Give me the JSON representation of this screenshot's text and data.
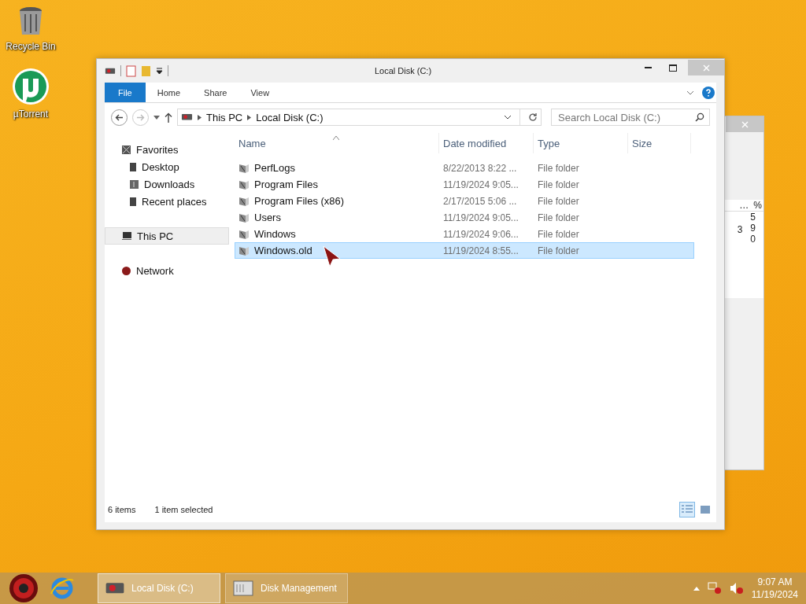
{
  "desktop_icons": [
    {
      "label": "Recycle Bin",
      "kind": "recycle"
    },
    {
      "label": "µTorrent",
      "kind": "torrent"
    }
  ],
  "back_window": {
    "header_cells": [
      "…",
      "%"
    ],
    "clipped_values": [
      "3"
    ],
    "percent_values": [
      "5",
      "9",
      "0"
    ]
  },
  "explorer": {
    "title": "Local Disk (C:)",
    "ribbon_tabs": [
      {
        "label": "File",
        "selected": true
      },
      {
        "label": "Home",
        "selected": false
      },
      {
        "label": "Share",
        "selected": false
      },
      {
        "label": "View",
        "selected": false
      }
    ],
    "breadcrumbs": [
      "This PC",
      "Local Disk (C:)"
    ],
    "search": {
      "placeholder": "Search Local Disk (C:)"
    },
    "nav": [
      {
        "label": "Favorites",
        "kind": "star",
        "selected": false,
        "children": [
          {
            "label": "Desktop",
            "kind": "desktop",
            "selected": false
          },
          {
            "label": "Downloads",
            "kind": "downloads",
            "selected": false
          },
          {
            "label": "Recent places",
            "kind": "recent",
            "selected": false
          }
        ]
      },
      {
        "label": "This PC",
        "kind": "pc",
        "selected": true
      },
      {
        "label": "Network",
        "kind": "network",
        "selected": false
      }
    ],
    "columns": [
      "Name",
      "Date modified",
      "Type",
      "Size"
    ],
    "rows": [
      {
        "name": "PerfLogs",
        "date": "8/22/2013 8:22 ...",
        "type": "File folder",
        "selected": false
      },
      {
        "name": "Program Files",
        "date": "11/19/2024 9:05...",
        "type": "File folder",
        "selected": false
      },
      {
        "name": "Program Files (x86)",
        "date": "2/17/2015 5:06 ...",
        "type": "File folder",
        "selected": false
      },
      {
        "name": "Users",
        "date": "11/19/2024 9:05...",
        "type": "File folder",
        "selected": false
      },
      {
        "name": "Windows",
        "date": "11/19/2024 9:06...",
        "type": "File folder",
        "selected": false
      },
      {
        "name": "Windows.old",
        "date": "11/19/2024 8:55...",
        "type": "File folder",
        "selected": true
      }
    ],
    "status": {
      "count": "6 items",
      "selection": "1 item selected"
    }
  },
  "taskbar": {
    "buttons": [
      {
        "label": "Local Disk (C:)",
        "kind": "drive",
        "selected": true
      },
      {
        "label": "Disk Management",
        "kind": "disk",
        "selected": false
      }
    ],
    "time": "9:07 AM",
    "date": "11/19/2024"
  }
}
